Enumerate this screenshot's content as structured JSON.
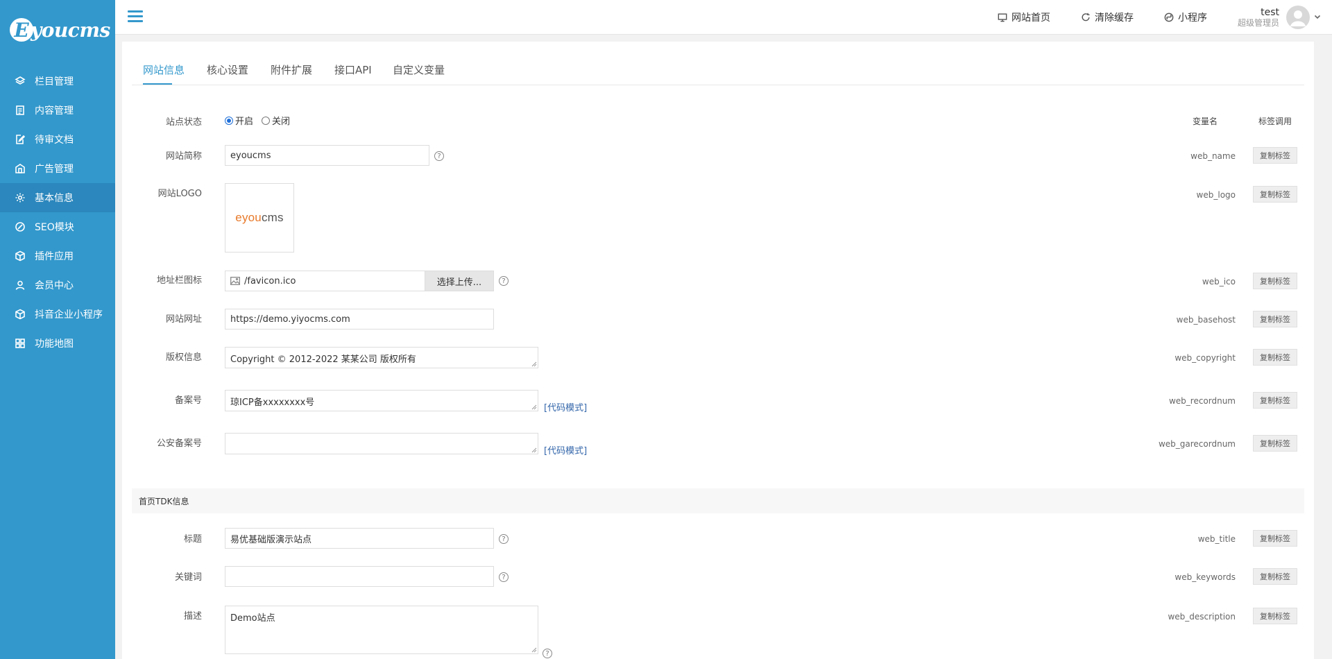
{
  "brand": {
    "logo_letter": "E",
    "logo_text": "youcms"
  },
  "sidebar": {
    "items": [
      {
        "label": "栏目管理",
        "icon": "layers-icon"
      },
      {
        "label": "内容管理",
        "icon": "document-icon"
      },
      {
        "label": "待审文档",
        "icon": "edit-document-icon"
      },
      {
        "label": "广告管理",
        "icon": "ad-icon"
      },
      {
        "label": "基本信息",
        "icon": "gear-icon",
        "active": true
      },
      {
        "label": "SEO模块",
        "icon": "seo-icon"
      },
      {
        "label": "插件应用",
        "icon": "cube-icon"
      },
      {
        "label": "会员中心",
        "icon": "user-icon"
      },
      {
        "label": "抖音企业小程序",
        "icon": "box-icon"
      },
      {
        "label": "功能地图",
        "icon": "grid-icon"
      }
    ]
  },
  "header": {
    "home_label": "网站首页",
    "clear_cache_label": "清除缓存",
    "miniprogram_label": "小程序",
    "user_name": "test",
    "user_role": "超级管理员"
  },
  "tabs": [
    {
      "label": "网站信息",
      "active": true
    },
    {
      "label": "核心设置"
    },
    {
      "label": "附件扩展"
    },
    {
      "label": "接口API"
    },
    {
      "label": "自定义变量"
    }
  ],
  "columns": {
    "var_name": "变量名",
    "tag_call": "标签调用"
  },
  "copy_label": "复制标签",
  "code_mode_label": "[代码模式]",
  "help_glyph": "?",
  "form": {
    "status": {
      "label": "站点状态",
      "opt_on": "开启",
      "opt_off": "关闭",
      "selected": "开启"
    },
    "web_name": {
      "label": "网站简称",
      "value": "eyoucms",
      "var": "web_name"
    },
    "web_logo": {
      "label": "网站LOGO",
      "var": "web_logo",
      "logo_text_a": "e",
      "logo_text_b": "you",
      "logo_text_c": "cms"
    },
    "web_ico": {
      "label": "地址栏图标",
      "value": "/favicon.ico",
      "button": "选择上传...",
      "var": "web_ico"
    },
    "web_basehost": {
      "label": "网站网址",
      "value": "https://demo.yiyocms.com",
      "var": "web_basehost"
    },
    "web_copyright": {
      "label": "版权信息",
      "value": "Copyright © 2012-2022 某某公司 版权所有",
      "var": "web_copyright"
    },
    "web_recordnum": {
      "label": "备案号",
      "value": "琼ICP备xxxxxxxx号",
      "var": "web_recordnum"
    },
    "web_garecordnum": {
      "label": "公安备案号",
      "value": "",
      "var": "web_garecordnum"
    }
  },
  "tdk": {
    "section_title": "首页TDK信息",
    "title": {
      "label": "标题",
      "value": "易优基础版演示站点",
      "var": "web_title"
    },
    "keywords": {
      "label": "关键词",
      "value": "",
      "var": "web_keywords"
    },
    "description": {
      "label": "描述",
      "value": "Demo站点",
      "var": "web_description"
    }
  },
  "colors": {
    "sidebar_bg": "#3398cc",
    "sidebar_active": "#2b87bd",
    "accent": "#3398cc",
    "link": "#3366aa"
  }
}
